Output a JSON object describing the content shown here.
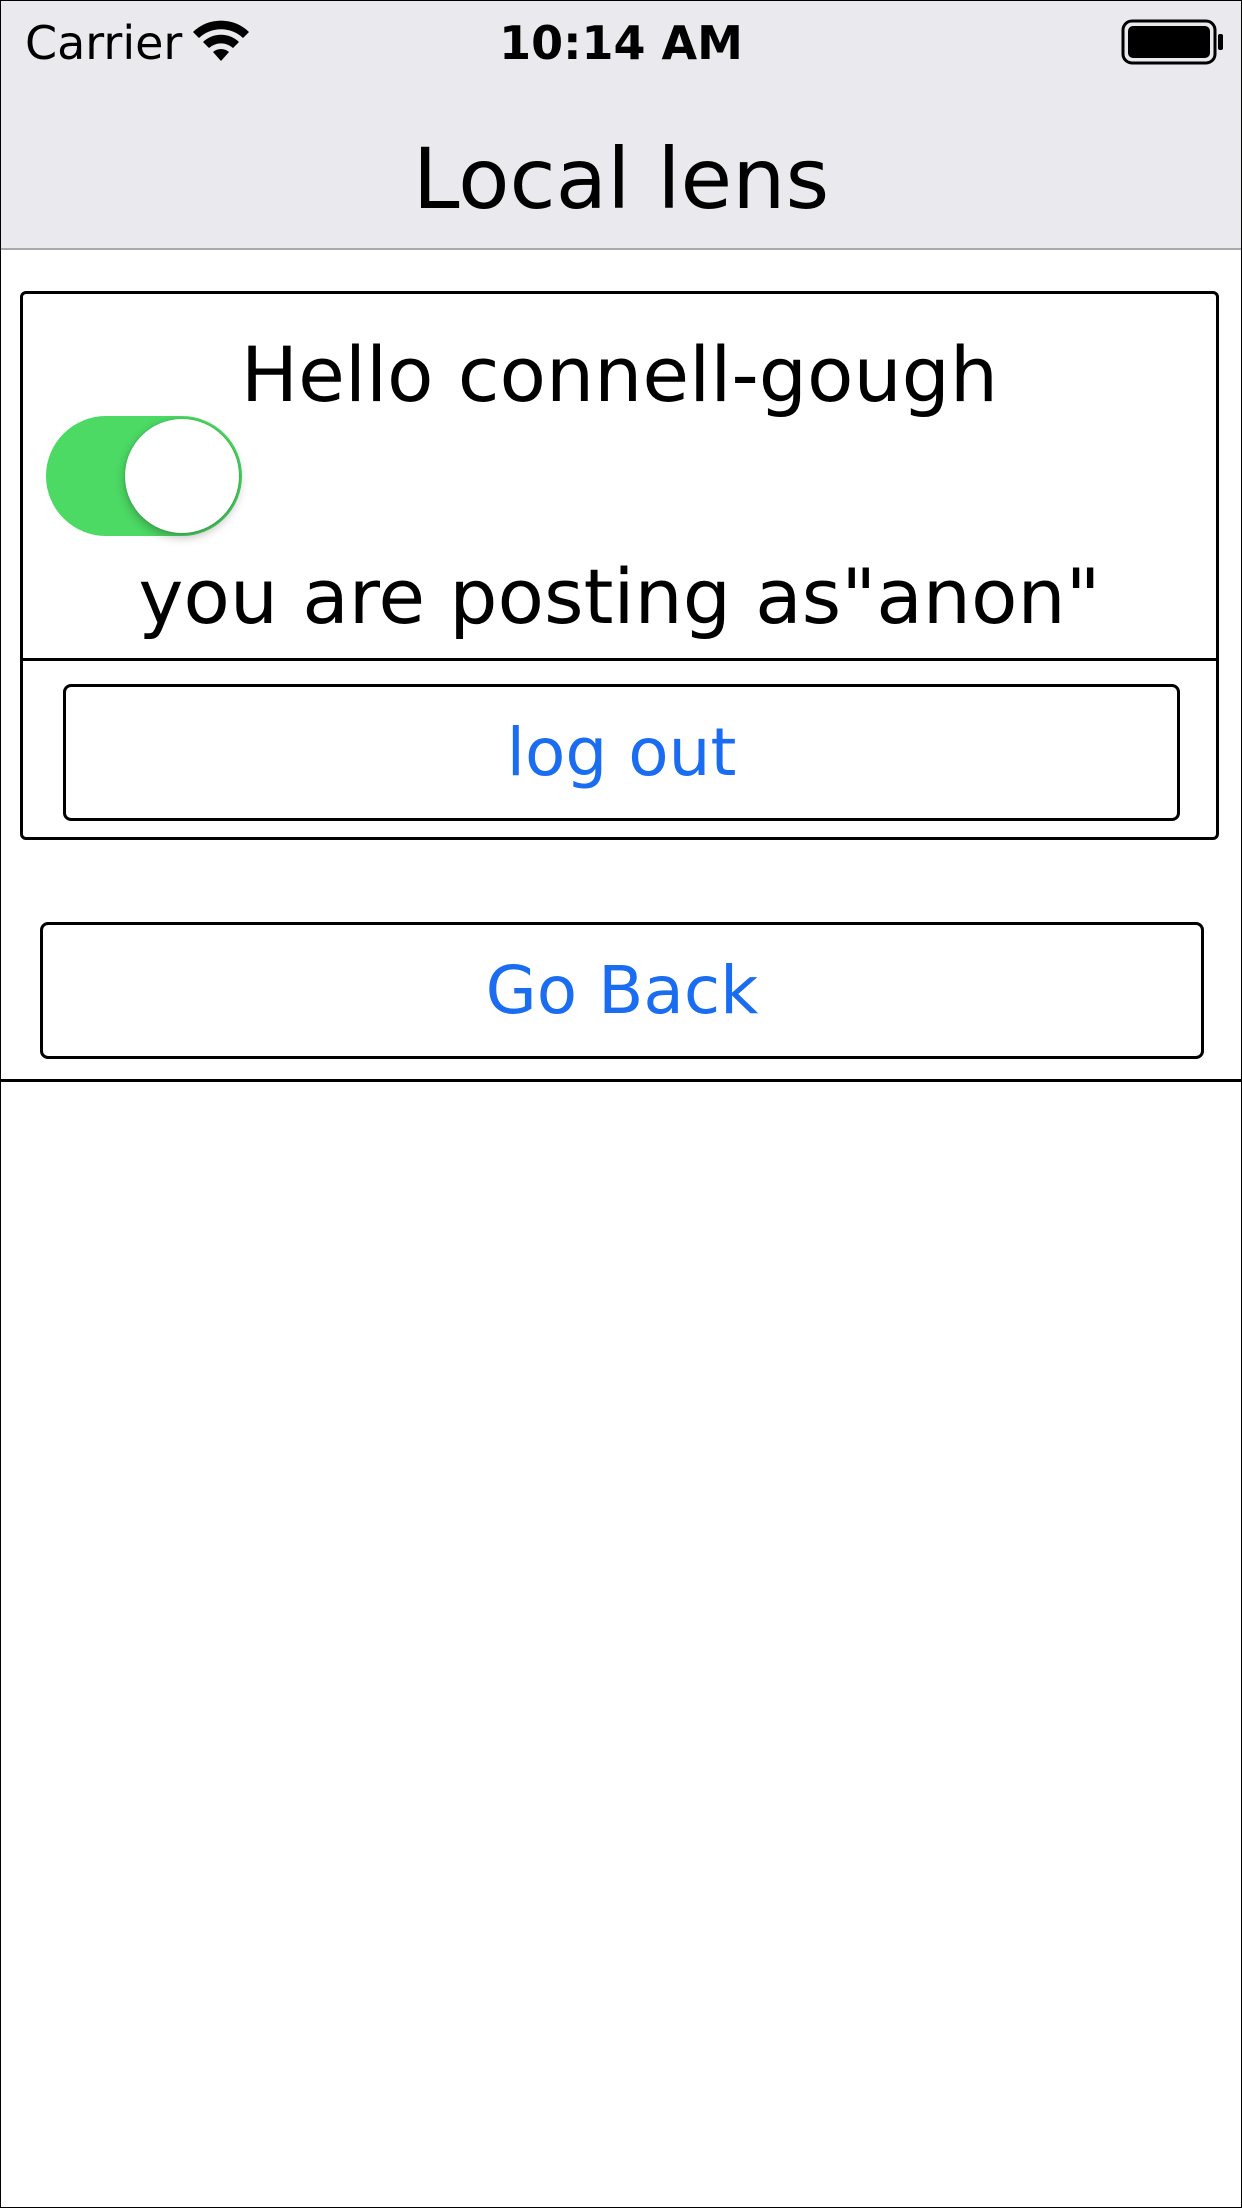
{
  "status_bar": {
    "carrier": "Carrier",
    "time": "10:14 AM",
    "wifi_icon": "wifi-icon",
    "battery_icon": "battery-full-icon",
    "battery_level": 1.0
  },
  "nav": {
    "title": "Local lens"
  },
  "account_card": {
    "greeting": "Hello connell-gough",
    "anon_toggle_on": true,
    "posting_as": "you are posting as\"anon\"",
    "logout_label": "log out"
  },
  "go_back_label": "Go Back",
  "colors": {
    "accent": "#1a6cf0",
    "toggle_on": "#4cd964",
    "nav_background": "#eaeaee"
  }
}
